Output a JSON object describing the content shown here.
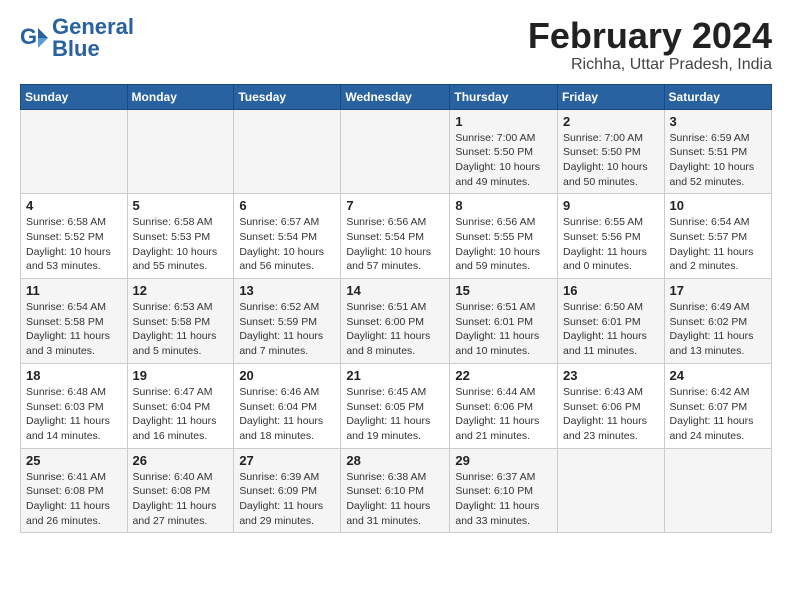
{
  "logo": {
    "line1": "General",
    "line2": "Blue"
  },
  "title": "February 2024",
  "subtitle": "Richha, Uttar Pradesh, India",
  "days_of_week": [
    "Sunday",
    "Monday",
    "Tuesday",
    "Wednesday",
    "Thursday",
    "Friday",
    "Saturday"
  ],
  "weeks": [
    [
      {
        "num": "",
        "info": ""
      },
      {
        "num": "",
        "info": ""
      },
      {
        "num": "",
        "info": ""
      },
      {
        "num": "",
        "info": ""
      },
      {
        "num": "1",
        "info": "Sunrise: 7:00 AM\nSunset: 5:50 PM\nDaylight: 10 hours\nand 49 minutes."
      },
      {
        "num": "2",
        "info": "Sunrise: 7:00 AM\nSunset: 5:50 PM\nDaylight: 10 hours\nand 50 minutes."
      },
      {
        "num": "3",
        "info": "Sunrise: 6:59 AM\nSunset: 5:51 PM\nDaylight: 10 hours\nand 52 minutes."
      }
    ],
    [
      {
        "num": "4",
        "info": "Sunrise: 6:58 AM\nSunset: 5:52 PM\nDaylight: 10 hours\nand 53 minutes."
      },
      {
        "num": "5",
        "info": "Sunrise: 6:58 AM\nSunset: 5:53 PM\nDaylight: 10 hours\nand 55 minutes."
      },
      {
        "num": "6",
        "info": "Sunrise: 6:57 AM\nSunset: 5:54 PM\nDaylight: 10 hours\nand 56 minutes."
      },
      {
        "num": "7",
        "info": "Sunrise: 6:56 AM\nSunset: 5:54 PM\nDaylight: 10 hours\nand 57 minutes."
      },
      {
        "num": "8",
        "info": "Sunrise: 6:56 AM\nSunset: 5:55 PM\nDaylight: 10 hours\nand 59 minutes."
      },
      {
        "num": "9",
        "info": "Sunrise: 6:55 AM\nSunset: 5:56 PM\nDaylight: 11 hours\nand 0 minutes."
      },
      {
        "num": "10",
        "info": "Sunrise: 6:54 AM\nSunset: 5:57 PM\nDaylight: 11 hours\nand 2 minutes."
      }
    ],
    [
      {
        "num": "11",
        "info": "Sunrise: 6:54 AM\nSunset: 5:58 PM\nDaylight: 11 hours\nand 3 minutes."
      },
      {
        "num": "12",
        "info": "Sunrise: 6:53 AM\nSunset: 5:58 PM\nDaylight: 11 hours\nand 5 minutes."
      },
      {
        "num": "13",
        "info": "Sunrise: 6:52 AM\nSunset: 5:59 PM\nDaylight: 11 hours\nand 7 minutes."
      },
      {
        "num": "14",
        "info": "Sunrise: 6:51 AM\nSunset: 6:00 PM\nDaylight: 11 hours\nand 8 minutes."
      },
      {
        "num": "15",
        "info": "Sunrise: 6:51 AM\nSunset: 6:01 PM\nDaylight: 11 hours\nand 10 minutes."
      },
      {
        "num": "16",
        "info": "Sunrise: 6:50 AM\nSunset: 6:01 PM\nDaylight: 11 hours\nand 11 minutes."
      },
      {
        "num": "17",
        "info": "Sunrise: 6:49 AM\nSunset: 6:02 PM\nDaylight: 11 hours\nand 13 minutes."
      }
    ],
    [
      {
        "num": "18",
        "info": "Sunrise: 6:48 AM\nSunset: 6:03 PM\nDaylight: 11 hours\nand 14 minutes."
      },
      {
        "num": "19",
        "info": "Sunrise: 6:47 AM\nSunset: 6:04 PM\nDaylight: 11 hours\nand 16 minutes."
      },
      {
        "num": "20",
        "info": "Sunrise: 6:46 AM\nSunset: 6:04 PM\nDaylight: 11 hours\nand 18 minutes."
      },
      {
        "num": "21",
        "info": "Sunrise: 6:45 AM\nSunset: 6:05 PM\nDaylight: 11 hours\nand 19 minutes."
      },
      {
        "num": "22",
        "info": "Sunrise: 6:44 AM\nSunset: 6:06 PM\nDaylight: 11 hours\nand 21 minutes."
      },
      {
        "num": "23",
        "info": "Sunrise: 6:43 AM\nSunset: 6:06 PM\nDaylight: 11 hours\nand 23 minutes."
      },
      {
        "num": "24",
        "info": "Sunrise: 6:42 AM\nSunset: 6:07 PM\nDaylight: 11 hours\nand 24 minutes."
      }
    ],
    [
      {
        "num": "25",
        "info": "Sunrise: 6:41 AM\nSunset: 6:08 PM\nDaylight: 11 hours\nand 26 minutes."
      },
      {
        "num": "26",
        "info": "Sunrise: 6:40 AM\nSunset: 6:08 PM\nDaylight: 11 hours\nand 27 minutes."
      },
      {
        "num": "27",
        "info": "Sunrise: 6:39 AM\nSunset: 6:09 PM\nDaylight: 11 hours\nand 29 minutes."
      },
      {
        "num": "28",
        "info": "Sunrise: 6:38 AM\nSunset: 6:10 PM\nDaylight: 11 hours\nand 31 minutes."
      },
      {
        "num": "29",
        "info": "Sunrise: 6:37 AM\nSunset: 6:10 PM\nDaylight: 11 hours\nand 33 minutes."
      },
      {
        "num": "",
        "info": ""
      },
      {
        "num": "",
        "info": ""
      }
    ]
  ]
}
